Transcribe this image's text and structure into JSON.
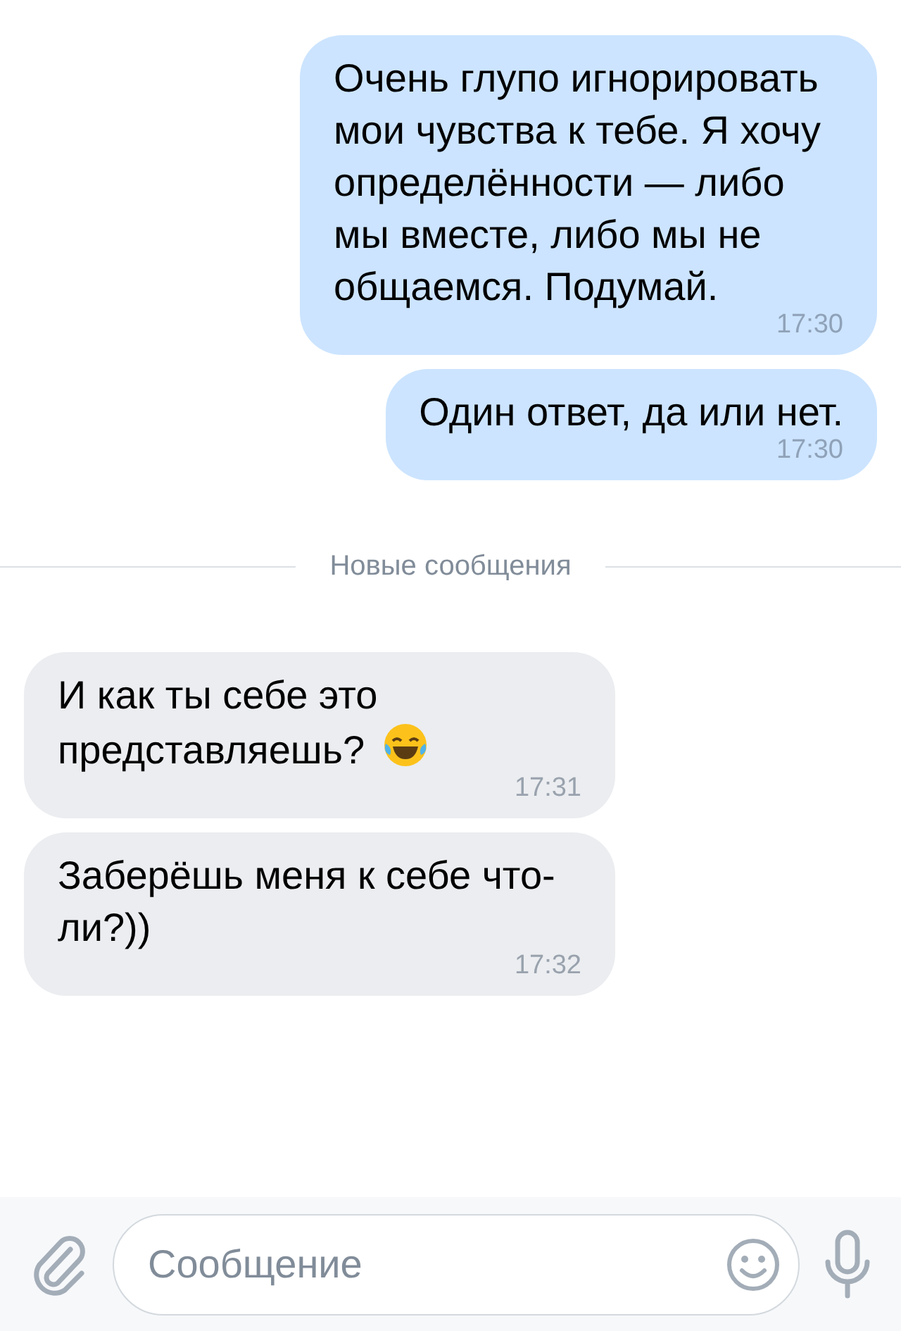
{
  "messages": [
    {
      "kind": "outgoing",
      "text": "Очень глупо игнорировать мои чувства к тебе. Я хочу определённости — либо мы вместе, либо мы не общаемся. Подумай.",
      "time": "17:30",
      "emoji": false
    },
    {
      "kind": "outgoing",
      "text": "Один ответ, да или нет.",
      "time": "17:30",
      "emoji": false
    },
    {
      "kind": "divider",
      "text": "Новые сообщения"
    },
    {
      "kind": "incoming",
      "text": "И как ты себе это представляешь?",
      "time": "17:31",
      "emoji": true
    },
    {
      "kind": "incoming",
      "text": "Заберёшь меня к себе что-ли?))",
      "time": "17:32",
      "emoji": false
    }
  ],
  "composer": {
    "placeholder": "Сообщение"
  }
}
